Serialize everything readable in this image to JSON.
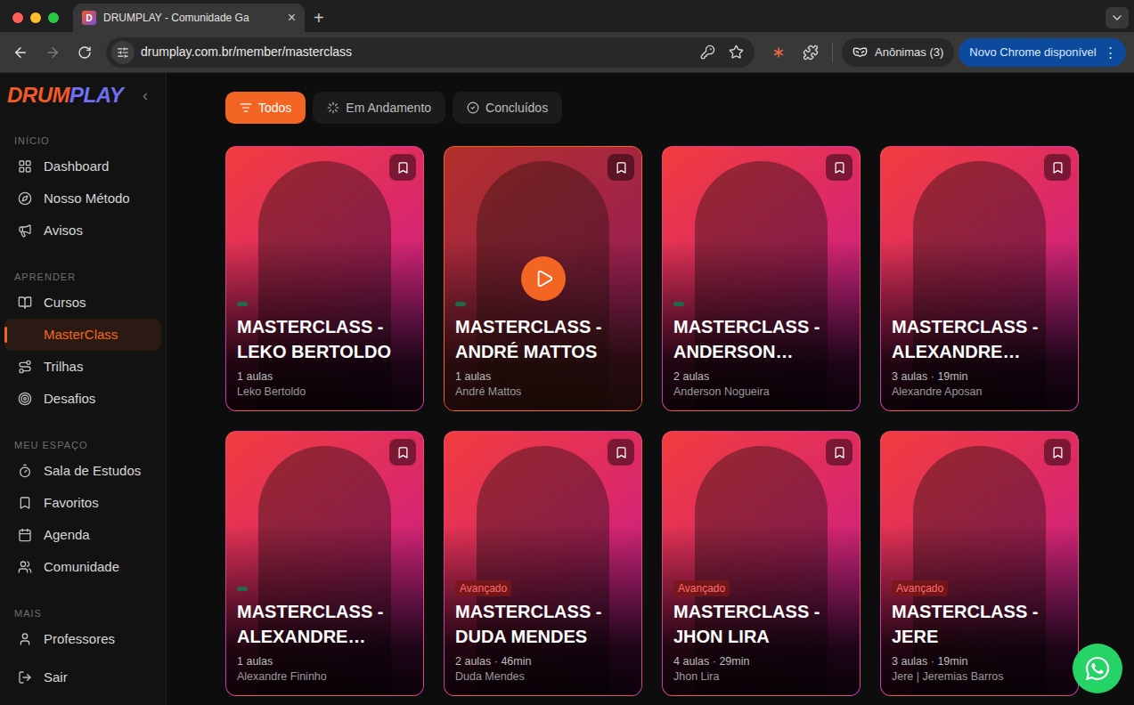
{
  "browser": {
    "tab": {
      "favicon": "D",
      "title": "DRUMPLAY - Comunidade Ga",
      "close": "×"
    },
    "new_tab": "+",
    "address": "drumplay.com.br/member/masterclass",
    "profile": "Anônimas (3)",
    "update": "Novo Chrome disponível",
    "menu": "⋮"
  },
  "sidebar": {
    "logo": {
      "drum": "DRUM",
      "play": "PLAY"
    },
    "collapse": "‹",
    "sections": [
      {
        "title": "INÍCIO",
        "items": [
          {
            "label": "Dashboard",
            "selected": false
          },
          {
            "label": "Nosso Método",
            "selected": false
          },
          {
            "label": "Avisos",
            "selected": false
          }
        ]
      },
      {
        "title": "APRENDER",
        "items": [
          {
            "label": "Cursos",
            "selected": false
          },
          {
            "label": "MasterClass",
            "selected": true
          },
          {
            "label": "Trilhas",
            "selected": false
          },
          {
            "label": "Desafios",
            "selected": false
          }
        ]
      },
      {
        "title": "MEU ESPAÇO",
        "items": [
          {
            "label": "Sala de Estudos",
            "selected": false
          },
          {
            "label": "Favoritos",
            "selected": false
          },
          {
            "label": "Agenda",
            "selected": false
          },
          {
            "label": "Comunidade",
            "selected": false
          }
        ]
      },
      {
        "title": "MAIS",
        "items": [
          {
            "label": "Professores",
            "selected": false
          }
        ]
      }
    ],
    "logout": {
      "label": "Sair"
    }
  },
  "filters": [
    {
      "label": "Todos",
      "selected": true
    },
    {
      "label": "Em Andamento",
      "selected": false
    },
    {
      "label": "Concluídos",
      "selected": false
    }
  ],
  "cards": [
    {
      "title": "MASTERCLASS - LEKO BERTOLDO",
      "meta": "1 aulas",
      "author": "Leko Bertoldo",
      "tag": true,
      "hovered": false
    },
    {
      "title": "MASTERCLASS - ANDRÉ MATTOS",
      "meta": "1 aulas",
      "author": "André Mattos",
      "tag": true,
      "hovered": true
    },
    {
      "title": "MASTERCLASS - ANDERSON…",
      "meta": "2 aulas",
      "author": "Anderson Nogueira",
      "tag": true,
      "hovered": false
    },
    {
      "title": "MASTERCLASS - ALEXANDRE…",
      "meta": "3 aulas · 19min",
      "author": "Alexandre Aposan",
      "tag": false,
      "hovered": false
    },
    {
      "title": "MASTERCLASS - ALEXANDRE…",
      "meta": "1 aulas",
      "author": "Alexandre Fininho",
      "tag": true,
      "hovered": false
    },
    {
      "title": "MASTERCLASS - DUDA MENDES",
      "meta": "2 aulas · 46min",
      "author": "Duda Mendes",
      "tag": false,
      "badge": "Avançado",
      "hovered": false
    },
    {
      "title": "MASTERCLASS - JHON LIRA",
      "meta": "4 aulas · 29min",
      "author": "Jhon Lira",
      "tag": false,
      "badge": "Avançado",
      "hovered": false
    },
    {
      "title": "MASTERCLASS - JERE",
      "meta": "3 aulas · 19min",
      "author": "Jere | Jeremias Barros",
      "tag": false,
      "badge": "Avançado",
      "hovered": false
    }
  ]
}
